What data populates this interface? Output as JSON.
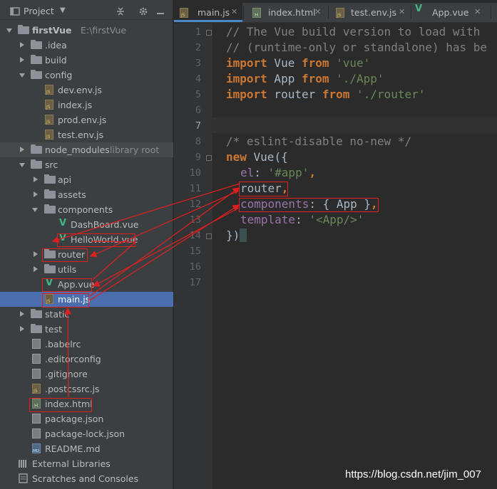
{
  "project_panel": {
    "title": "Project",
    "header_icons": [
      "collapse-icon",
      "gear-icon",
      "minimize-icon"
    ]
  },
  "tree": [
    {
      "label": "firstVue",
      "hint": "E:\\firstVue",
      "type": "folder",
      "state": "open"
    },
    {
      "label": ".idea",
      "type": "folder",
      "state": "closed"
    },
    {
      "label": "build",
      "type": "folder",
      "state": "closed"
    },
    {
      "label": "config",
      "type": "folder",
      "state": "open"
    },
    {
      "label": "dev.env.js",
      "type": "js"
    },
    {
      "label": "index.js",
      "type": "js"
    },
    {
      "label": "prod.env.js",
      "type": "js"
    },
    {
      "label": "test.env.js",
      "type": "js"
    },
    {
      "label": "node_modules",
      "hint": "library root",
      "type": "folder",
      "state": "closed"
    },
    {
      "label": "src",
      "type": "folder",
      "state": "open"
    },
    {
      "label": "api",
      "type": "folder",
      "state": "closed"
    },
    {
      "label": "assets",
      "type": "folder",
      "state": "closed"
    },
    {
      "label": "components",
      "type": "folder",
      "state": "open"
    },
    {
      "label": "DashBoard.vue",
      "type": "vue"
    },
    {
      "label": "HelloWorld.vue",
      "type": "vue"
    },
    {
      "label": "router",
      "type": "folder",
      "state": "closed"
    },
    {
      "label": "utils",
      "type": "folder",
      "state": "closed"
    },
    {
      "label": "App.vue",
      "type": "vue"
    },
    {
      "label": "main.js",
      "type": "js",
      "selected": true
    },
    {
      "label": "static",
      "type": "folder",
      "state": "closed"
    },
    {
      "label": "test",
      "type": "folder",
      "state": "closed"
    },
    {
      "label": ".babelrc",
      "type": "plain"
    },
    {
      "label": ".editorconfig",
      "type": "plain"
    },
    {
      "label": ".gitignore",
      "type": "plain"
    },
    {
      "label": ".postcssrc.js",
      "type": "js"
    },
    {
      "label": "index.html",
      "type": "html"
    },
    {
      "label": "package.json",
      "type": "plain"
    },
    {
      "label": "package-lock.json",
      "type": "plain"
    },
    {
      "label": "README.md",
      "type": "md"
    },
    {
      "label": "External Libraries",
      "type": "libs"
    },
    {
      "label": "Scratches and Consoles",
      "type": "scratch"
    }
  ],
  "tabs": [
    {
      "label": "main.js",
      "active": true
    },
    {
      "label": "index.html"
    },
    {
      "label": "test.env.js"
    },
    {
      "label": "App.vue"
    }
  ],
  "editor": {
    "line_numbers": [
      "1",
      "2",
      "3",
      "4",
      "5",
      "6",
      "7",
      "8",
      "9",
      "10",
      "11",
      "12",
      "13",
      "14",
      "15",
      "16",
      "17"
    ],
    "current_line": "7",
    "lines": {
      "l1": "// The Vue build version to load with",
      "l2": "// (runtime-only or standalone) has be",
      "l3_kw1": "import",
      "l3_id": " Vue ",
      "l3_kw2": "from",
      "l3_str": " 'vue'",
      "l4_kw1": "import",
      "l4_id": " App ",
      "l4_kw2": "from",
      "l4_str": " './App'",
      "l5_kw1": "import",
      "l5_id": " router ",
      "l5_kw2": "from",
      "l5_str": " './router'",
      "l8": "/* eslint-disable no-new */",
      "l9_kw": "new",
      "l9_rest": " Vue({",
      "l10_key": "el",
      "l10_colon": ": ",
      "l10_str": "'#app'",
      "l10_comma": ",",
      "l11_key": "router",
      "l11_comma": ",",
      "l12_key": "components",
      "l12_rest": ": { App }",
      "l12_comma": ",",
      "l13_key": "template",
      "l13_colon": ": ",
      "l13_str": "'<App/>'",
      "l14": "})"
    }
  },
  "annotation_color": "#e0201f",
  "watermark": "https://blog.csdn.net/jim_007"
}
